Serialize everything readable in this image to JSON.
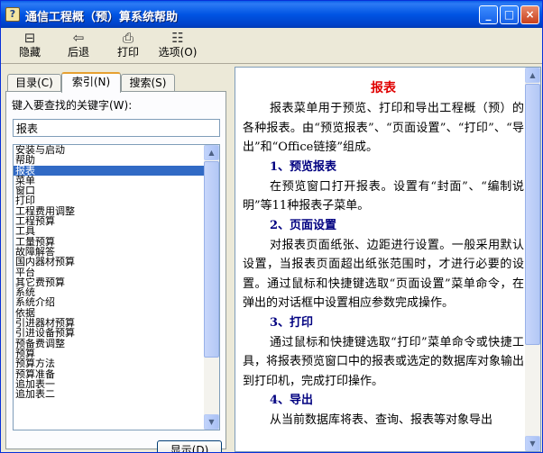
{
  "window": {
    "title": "通信工程概（预）算系统帮助",
    "app_icon_glyph": "?",
    "minimize_glyph": "_",
    "maximize_glyph": "□",
    "close_glyph": "×"
  },
  "toolbar": {
    "buttons": [
      {
        "label": "隐藏",
        "icon": "hide-icon",
        "glyph": "⊟"
      },
      {
        "label": "后退",
        "icon": "back-arrow-icon",
        "glyph": "⇦"
      },
      {
        "label": "打印",
        "icon": "print-icon",
        "glyph": "⎙"
      },
      {
        "label": "选项(O)",
        "icon": "options-icon",
        "glyph": "☷"
      }
    ]
  },
  "nav": {
    "tabs": [
      {
        "label": "目录(C)",
        "active": false
      },
      {
        "label": "索引(N)",
        "active": true
      },
      {
        "label": "搜索(S)",
        "active": false
      }
    ],
    "keyword_label": "键入要查找的关键字(W):",
    "keyword_value": "报表",
    "index_items": [
      "安装与启动",
      "帮助",
      "报表",
      "菜单",
      "窗口",
      "打印",
      "工程费用调整",
      "工程预算",
      "工具",
      "工量预算",
      "故障解答",
      "国内器材预算",
      "平台",
      "其它费预算",
      "系统",
      "系统介绍",
      "依据",
      "引进器材预算",
      "引进设备预算",
      "预备费调整",
      "预算",
      "预算方法",
      "预算准备",
      "追加表一",
      "追加表二"
    ],
    "selected_index": 2,
    "show_button": "显示(D)"
  },
  "content": {
    "title": "报表",
    "intro": "报表菜单用于预览、打印和导出工程概（预）的各种报表。由“预览报表”、“页面设置”、“打印”、“导出”和“Office链接”组成。",
    "sections": [
      {
        "heading": "1、预览报表",
        "text": "在预览窗口打开报表。设置有“封面”、“编制说明”等11种报表子菜单。"
      },
      {
        "heading": "2、页面设置",
        "text": "对报表页面纸张、边距进行设置。一般采用默认设置，当报表页面超出纸张范围时，才进行必要的设置。通过鼠标和快捷键选取“页面设置”菜单命令，在弹出的对话框中设置相应参数完成操作。"
      },
      {
        "heading": "3、打印",
        "text": "通过鼠标和快捷键选取“打印”菜单命令或快捷工具，将报表预览窗口中的报表或选定的数据库对象输出到打印机，完成打印操作。"
      },
      {
        "heading": "4、导出",
        "text": "从当前数据库将表、查询、报表等对象导出"
      }
    ]
  },
  "colors": {
    "titlebar": "#0054e3",
    "selection": "#316ac5",
    "content_title": "#e00000",
    "section_heading": "#000080"
  }
}
